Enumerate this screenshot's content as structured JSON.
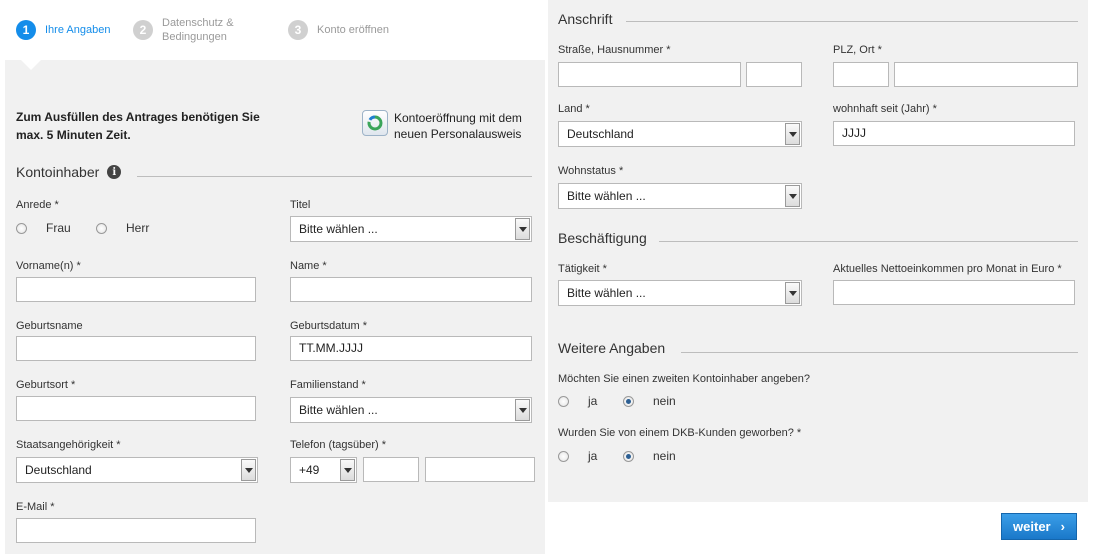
{
  "stepper": {
    "steps": [
      {
        "num": "1",
        "label": "Ihre Angaben"
      },
      {
        "num": "2",
        "label_line1": "Datenschutz &",
        "label_line2": "Bedingungen"
      },
      {
        "num": "3",
        "label": "Konto eröffnen"
      }
    ]
  },
  "intro": {
    "line1": "Zum Ausfüllen des Antrages benötigen Sie",
    "line2": "max. 5 Minuten Zeit."
  },
  "ausweis": {
    "line1": "Kontoeröffnung mit dem",
    "line2": "neuen Personalausweis"
  },
  "kontoinhaber": {
    "heading": "Kontoinhaber",
    "anrede_label": "Anrede *",
    "anrede_options": [
      "Frau",
      "Herr"
    ],
    "titel_label": "Titel",
    "titel_value": "Bitte wählen ...",
    "vorname_label": "Vorname(n) *",
    "vorname_value": "",
    "name_label": "Name *",
    "name_value": "",
    "geburtsname_label": "Geburtsname",
    "geburtsname_value": "",
    "geburtsdatum_label": "Geburtsdatum *",
    "geburtsdatum_value": "TT.MM.JJJJ",
    "geburtsort_label": "Geburtsort *",
    "geburtsort_value": "",
    "familienstand_label": "Familienstand *",
    "familienstand_value": "Bitte wählen ...",
    "staatsangehoerigkeit_label": "Staatsangehörigkeit *",
    "staatsangehoerigkeit_value": "Deutschland",
    "telefon_label": "Telefon (tagsüber) *",
    "telefon_prefix": "+49",
    "email_label": "E-Mail *",
    "email_value": ""
  },
  "anschrift": {
    "heading": "Anschrift",
    "strasse_label": "Straße, Hausnummer *",
    "plz_label": "PLZ, Ort *",
    "land_label": "Land *",
    "land_value": "Deutschland",
    "wohnhaft_label": "wohnhaft seit (Jahr) *",
    "wohnhaft_value": "JJJJ",
    "wohnstatus_label": "Wohnstatus *",
    "wohnstatus_value": "Bitte wählen ..."
  },
  "beschaeftigung": {
    "heading": "Beschäftigung",
    "taetigkeit_label": "Tätigkeit *",
    "taetigkeit_value": "Bitte wählen ...",
    "einkommen_label": "Aktuelles Nettoeinkommen pro Monat in Euro *",
    "einkommen_value": ""
  },
  "weitere": {
    "heading": "Weitere Angaben",
    "q1": "Möchten Sie einen zweiten Kontoinhaber angeben?",
    "q2": "Wurden Sie von einem DKB-Kunden geworben? *",
    "ja": "ja",
    "nein": "nein"
  },
  "footer": {
    "weiter_label": "weiter",
    "weiter_chevron": "›"
  },
  "colors": {
    "accent": "#148dea",
    "panel_bg": "#f1f1f1"
  }
}
